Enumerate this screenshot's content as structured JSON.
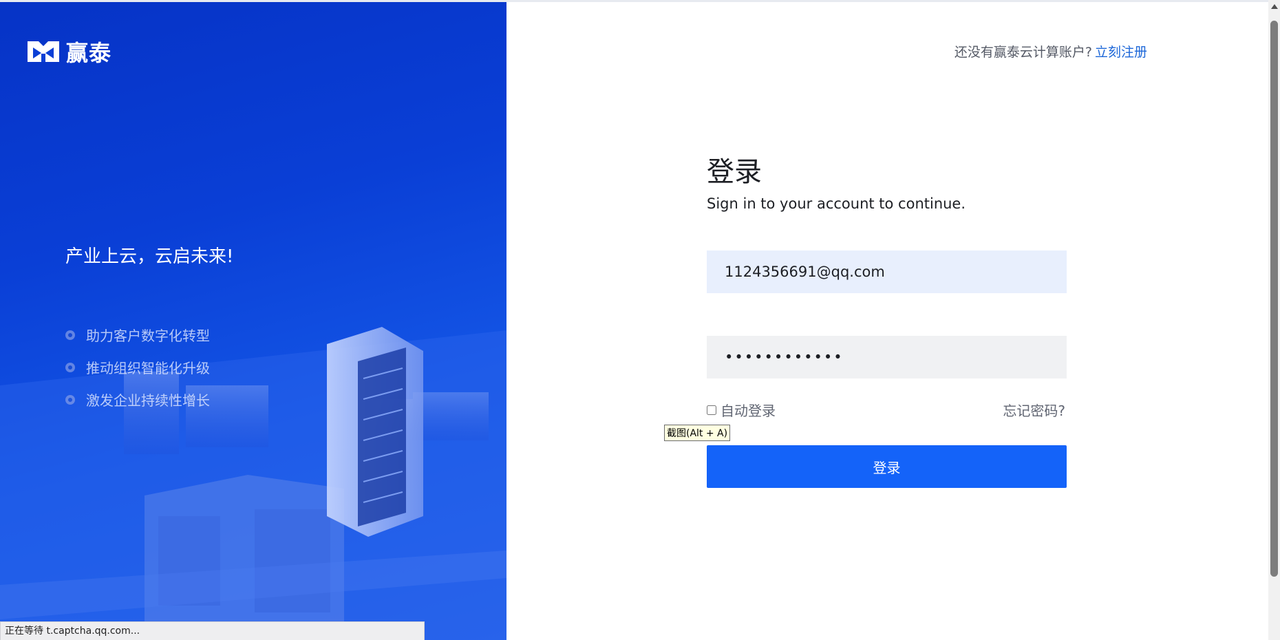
{
  "brand": {
    "name": "赢泰",
    "logo_icon": "yingtai-logo-icon"
  },
  "hero": {
    "slogan": "产业上云，云启未来!",
    "features": [
      "助力客户数字化转型",
      "推动组织智能化升级",
      "激发企业持续性增长"
    ]
  },
  "header": {
    "register_prompt": "还没有赢泰云计算账户?",
    "register_link": "立刻注册"
  },
  "login": {
    "title": "登录",
    "subtitle": "Sign in to your account to continue.",
    "email_value": "1124356691@qq.com",
    "password_value": "••••••••••••",
    "auto_login_label": "自动登录",
    "auto_login_checked": false,
    "forgot_label": "忘记密码?",
    "submit_label": "登录"
  },
  "tooltip": {
    "text": "截图(Alt + A)"
  },
  "status_bar": {
    "text": "正在等待 t.captcha.qq.com..."
  },
  "colors": {
    "primary": "#1463f9",
    "link": "#1b66d8",
    "hero_bg": "#0a3fd6",
    "email_bg": "#e8effd"
  }
}
